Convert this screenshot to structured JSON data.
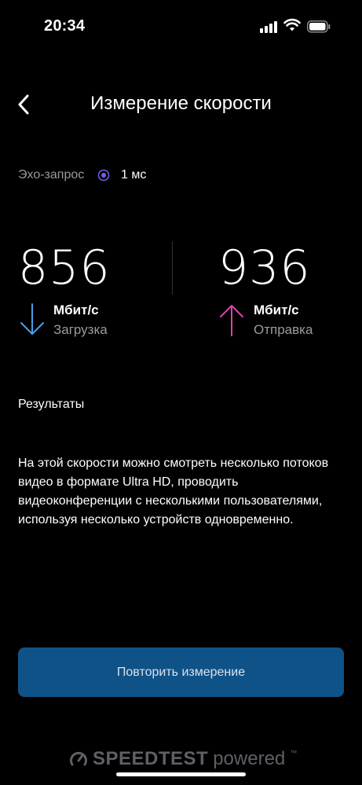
{
  "status_bar": {
    "time": "20:34"
  },
  "header": {
    "title": "Измерение скорости"
  },
  "ping": {
    "label": "Эхо-запрос",
    "value": "1 мс",
    "dot_color": "#7b5cf0"
  },
  "download": {
    "value": "856",
    "unit": "Мбит/с",
    "label": "Загрузка",
    "arrow_color": "#4a9fe8"
  },
  "upload": {
    "value": "936",
    "unit": "Мбит/с",
    "label": "Отправка",
    "arrow_color": "#e040b0"
  },
  "results": {
    "title": "Результаты",
    "text": "На этой скорости можно смотреть несколько потоков видео в формате Ultra HD, проводить видеоконференции с несколькими пользователями, используя несколько устройств одновременно."
  },
  "retry_button": {
    "label": "Повторить измерение",
    "color": "#0f5287"
  },
  "footer": {
    "brand": "SPEEDTEST",
    "suffix": "powered",
    "tm": "™"
  }
}
